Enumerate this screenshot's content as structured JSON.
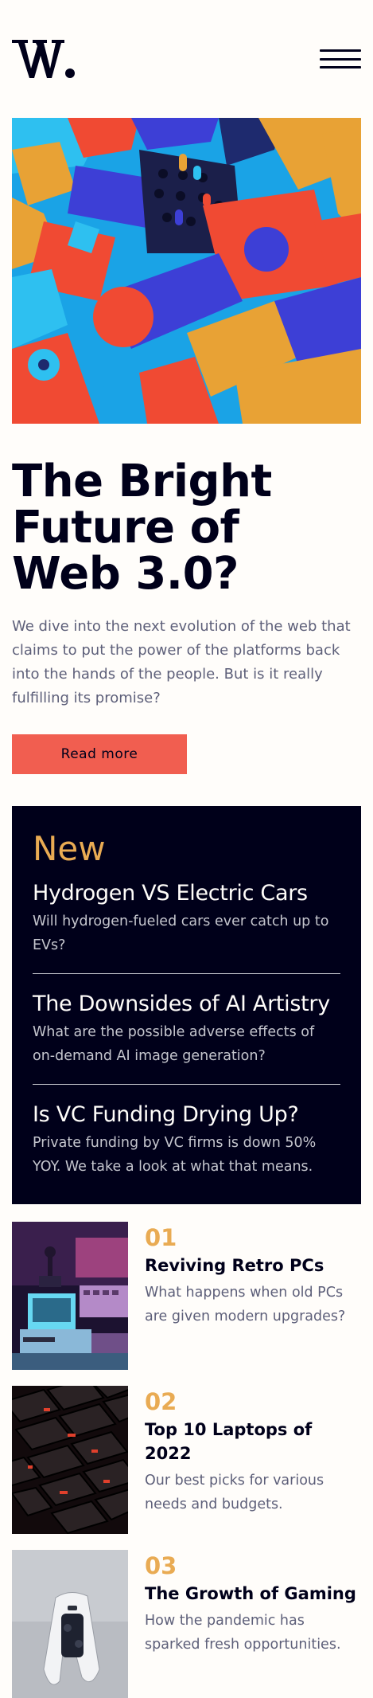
{
  "header": {
    "logo_text": "W.",
    "menu_label": "Menu"
  },
  "hero": {
    "image_icon": "abstract-3d-shapes-image",
    "headline": "The Bright Future of Web 3.0?",
    "lede": "We dive into the next evolution of the web that claims to put the power of the platforms back into the hands of the people. But is it really fulfilling its promise?",
    "cta_label": "Read more"
  },
  "new_section": {
    "title": "New",
    "items": [
      {
        "title": "Hydrogen VS Electric Cars",
        "desc": "Will hydrogen-fueled cars ever catch up to EVs?"
      },
      {
        "title": "The Downsides of AI Artistry",
        "desc": "What are the possible adverse effects of on-demand AI image generation?"
      },
      {
        "title": "Is VC Funding Drying Up?",
        "desc": "Private funding by VC firms is down 50% YOY. We take a look at what that means."
      }
    ]
  },
  "list": [
    {
      "num": "01",
      "title": "Reviving Retro PCs",
      "desc": "What happens when old PCs are given modern upgrades?",
      "image_icon": "retro-pc-image"
    },
    {
      "num": "02",
      "title": "Top 10 Laptops of 2022",
      "desc": "Our best picks for various needs and budgets.",
      "image_icon": "laptop-keyboard-image"
    },
    {
      "num": "03",
      "title": "The Growth of Gaming",
      "desc": "How the pandemic has sparked fresh opportunities.",
      "image_icon": "game-controller-image"
    }
  ],
  "colors": {
    "background": "#fffdfa",
    "ink": "#00001a",
    "accent_red": "#f15e50",
    "accent_orange": "#e9ab53",
    "muted": "#5d5f79",
    "light_gray": "#c5c6ce"
  }
}
